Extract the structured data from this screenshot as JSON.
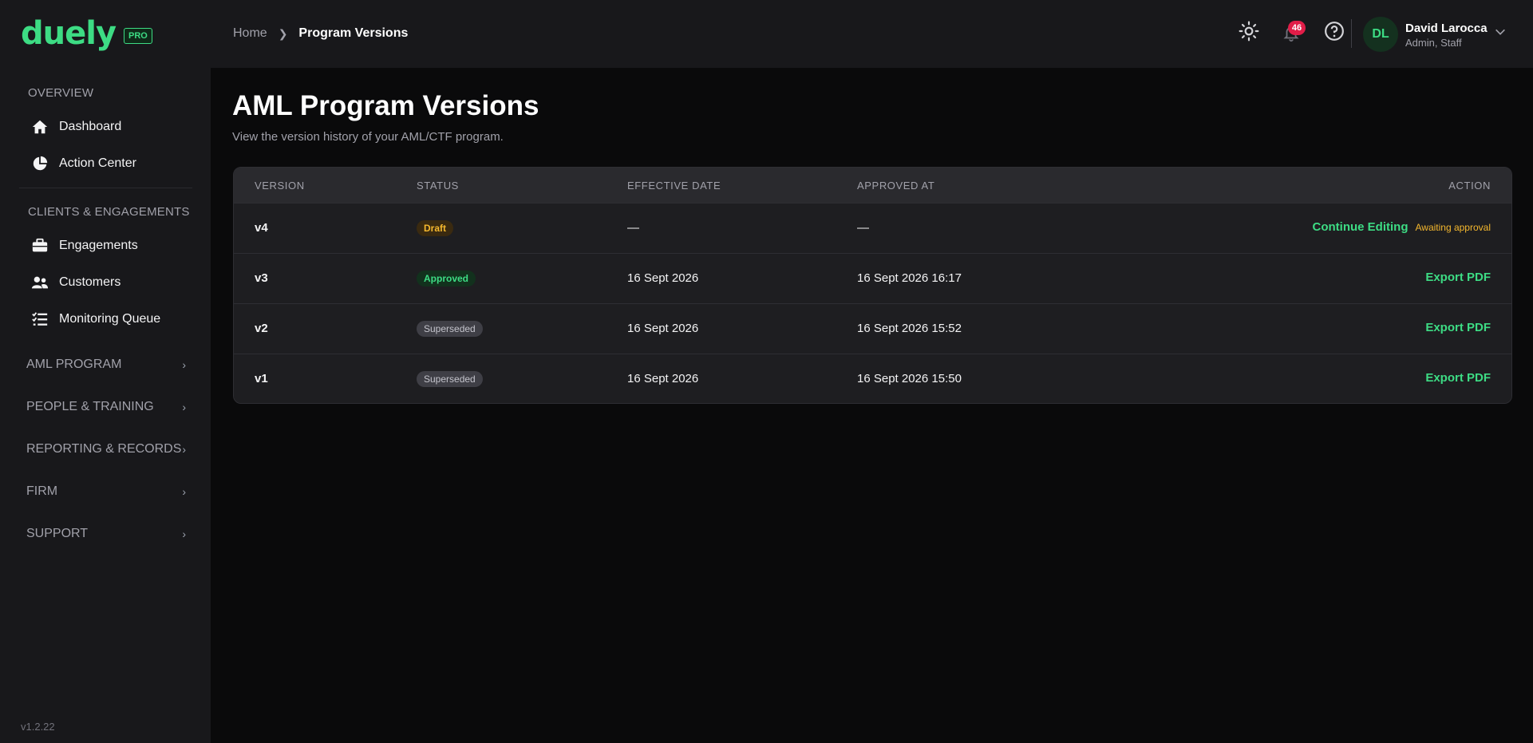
{
  "brand": {
    "name": "duely",
    "badge": "PRO",
    "accent": "#3ddc84"
  },
  "sidebar": {
    "overview_label": "OVERVIEW",
    "overview_items": [
      {
        "label": "Dashboard",
        "icon": "home-icon"
      },
      {
        "label": "Action Center",
        "icon": "pie-chart-icon"
      }
    ],
    "clients_label": "CLIENTS & ENGAGEMENTS",
    "clients_items": [
      {
        "label": "Engagements",
        "icon": "briefcase-icon"
      },
      {
        "label": "Customers",
        "icon": "users-icon"
      },
      {
        "label": "Monitoring Queue",
        "icon": "list-check-icon"
      }
    ],
    "groups": [
      {
        "label": "AML PROGRAM"
      },
      {
        "label": "PEOPLE & TRAINING"
      },
      {
        "label": "REPORTING & RECORDS"
      },
      {
        "label": "FIRM"
      },
      {
        "label": "SUPPORT"
      }
    ],
    "version": "v1.2.22"
  },
  "header": {
    "breadcrumb": {
      "home": "Home",
      "current": "Program Versions"
    },
    "notifications_count": "46",
    "user": {
      "initials": "DL",
      "name": "David Larocca",
      "role": "Admin, Staff"
    }
  },
  "main": {
    "title": "AML Program Versions",
    "subtitle": "View the version history of your AML/CTF program.",
    "table": {
      "columns": {
        "version": "VERSION",
        "status": "STATUS",
        "effective": "EFFECTIVE DATE",
        "approved": "APPROVED AT",
        "action": "ACTION"
      },
      "rows": [
        {
          "version": "v4",
          "status": "Draft",
          "effective": "—",
          "approved": "—",
          "action": "Continue Editing",
          "note": "Awaiting approval"
        },
        {
          "version": "v3",
          "status": "Approved",
          "effective": "16 Sept 2026",
          "approved": "16 Sept 2026 16:17",
          "action": "Export PDF"
        },
        {
          "version": "v2",
          "status": "Superseded",
          "effective": "16 Sept 2026",
          "approved": "16 Sept 2026 15:52",
          "action": "Export PDF"
        },
        {
          "version": "v1",
          "status": "Superseded",
          "effective": "16 Sept 2026",
          "approved": "16 Sept 2026 15:50",
          "action": "Export PDF"
        }
      ]
    }
  }
}
